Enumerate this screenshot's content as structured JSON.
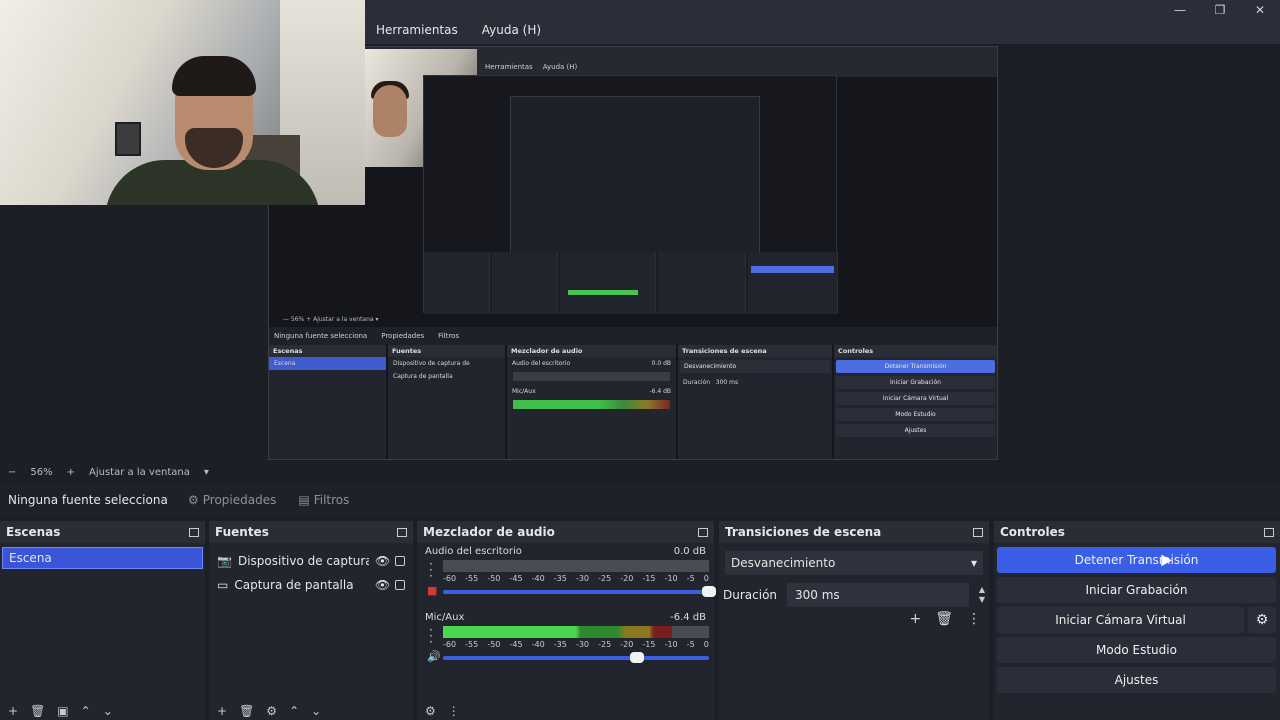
{
  "window": {
    "controls": [
      "—",
      "❐",
      "✕"
    ],
    "menu": [
      "Herramientas",
      "Ayuda (H)"
    ]
  },
  "preview": {
    "menu": [
      "Herramientas",
      "Ayuda (H)"
    ],
    "zoom_text": "—   56%   +   Ajustar a la ventana   ▾",
    "source_none": "Ninguna fuente selecciona",
    "props": "Propiedades",
    "filters": "Filtros",
    "docks": {
      "scenes_title": "Escenas",
      "scene": "Escena",
      "sources_title": "Fuentes",
      "source1": "Dispositivo de captura de",
      "source2": "Captura de pantalla",
      "mixer_title": "Mezclador de audio",
      "desktop": "Audio del escritorio",
      "desktop_db": "0.0 dB",
      "mic": "Mic/Aux",
      "mic_db": "-6.4 dB",
      "trans_title": "Transiciones de escena",
      "trans_sel": "Desvanecimiento",
      "dur_label": "Duración",
      "dur_val": "300 ms",
      "ctrl_title": "Controles",
      "btn_stop": "Detener Transmisión",
      "btn_rec": "Iniciar Grabación",
      "btn_vcam": "Iniciar Cámara Virtual",
      "btn_studio": "Modo Estudio",
      "btn_settings": "Ajustes"
    }
  },
  "zoombar": {
    "minus": "−",
    "zoom": "56%",
    "plus": "+",
    "fit": "Ajustar a la ventana",
    "chevron": "▾"
  },
  "sourcebar": {
    "none_selected": "Ninguna fuente selecciona",
    "properties": "Propiedades",
    "filters": "Filtros"
  },
  "scenes": {
    "title": "Escenas",
    "items": [
      "Escena"
    ],
    "footer_icons": [
      "+",
      "🗑",
      "▣",
      "⌃",
      "⌄"
    ]
  },
  "sources": {
    "title": "Fuentes",
    "items": [
      {
        "name": "Dispositivo de captura de",
        "icon": "camera-icon"
      },
      {
        "name": "Captura de pantalla",
        "icon": "monitor-icon"
      }
    ],
    "footer_icons": [
      "+",
      "🗑",
      "⚙",
      "⌃",
      "⌄"
    ]
  },
  "mixer": {
    "title": "Mezclador de audio",
    "ticks": [
      "-60",
      "-55",
      "-50",
      "-45",
      "-40",
      "-35",
      "-30",
      "-25",
      "-20",
      "-15",
      "-10",
      "-5",
      "0"
    ],
    "channels": [
      {
        "name": "Audio del escritorio",
        "db": "0.0 dB",
        "level": 0.0,
        "volume": 1.0,
        "muted": true
      },
      {
        "name": "Mic/Aux",
        "db": "-6.4 dB",
        "level": 0.86,
        "volume": 0.73,
        "muted": false
      }
    ],
    "footer_icons": [
      "⚙",
      "⋮"
    ]
  },
  "transitions": {
    "title": "Transiciones de escena",
    "selected": "Desvanecimiento",
    "duration_label": "Duración",
    "duration_value": "300 ms"
  },
  "controls": {
    "title": "Controles",
    "stop_stream": "Detener Transmisión",
    "start_recording": "Iniciar Grabación",
    "start_vcam": "Iniciar Cámara Virtual",
    "studio_mode": "Modo Estudio",
    "settings": "Ajustes"
  },
  "colors": {
    "accent": "#3a5fe6",
    "background": "#1d1f26",
    "panel": "#23252e"
  }
}
